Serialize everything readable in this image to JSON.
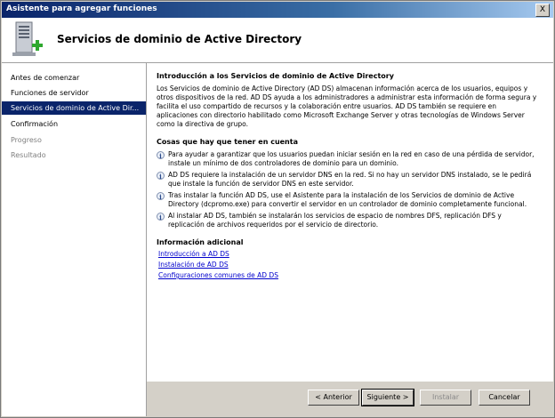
{
  "window": {
    "title": "Asistente para agregar funciones",
    "close_label": "X"
  },
  "header": {
    "title": "Servicios de dominio de Active Directory"
  },
  "sidebar": {
    "items": [
      {
        "label": "Antes de comenzar",
        "state": "normal"
      },
      {
        "label": "Funciones de servidor",
        "state": "normal"
      },
      {
        "label": "Servicios de dominio de Active Dir...",
        "state": "selected"
      },
      {
        "label": "Confirmación",
        "state": "normal"
      },
      {
        "label": "Progreso",
        "state": "disabled"
      },
      {
        "label": "Resultado",
        "state": "disabled"
      }
    ]
  },
  "content": {
    "intro_heading": "Introducción a los Servicios de dominio de Active Directory",
    "intro_text": "Los Servicios de dominio de Active Directory (AD DS) almacenan información acerca de los usuarios, equipos y otros dispositivos de la red. AD DS ayuda a los administradores a administrar esta información de forma segura y facilita el uso compartido de recursos y la colaboración entre usuarios. AD DS también se requiere en aplicaciones con directorio habilitado como Microsoft Exchange Server y otras tecnologías de Windows Server como la directiva de grupo.",
    "notes_heading": "Cosas que hay que tener en cuenta",
    "notes": [
      "Para ayudar a garantizar que los usuarios puedan iniciar sesión en la red en caso de una pérdida de servidor, instale un mínimo de dos controladores de dominio para un dominio.",
      "AD DS requiere la instalación de un servidor DNS en la red. Si no hay un servidor DNS instalado, se le pedirá que instale la función de servidor DNS en este servidor.",
      "Tras instalar la función AD DS, use el Asistente para la instalación de los Servicios de dominio de Active Directory (dcpromo.exe) para convertir el servidor en un controlador de dominio completamente funcional.",
      "Al instalar AD DS, también se instalarán los servicios de espacio de nombres DFS, replicación DFS y replicación de archivos requeridos por el servicio de directorio."
    ],
    "info_icon_glyph": "i",
    "more_heading": "Información adicional",
    "links": [
      "Introducción a AD DS",
      "Instalación de AD DS",
      "Configuraciones comunes de AD DS"
    ]
  },
  "buttons": {
    "back": "< Anterior",
    "next": "Siguiente >",
    "install": "Instalar",
    "cancel": "Cancelar"
  },
  "colors": {
    "selection": "#0a246a",
    "link": "#0000cc",
    "plus_icon": "#2ea82e"
  }
}
